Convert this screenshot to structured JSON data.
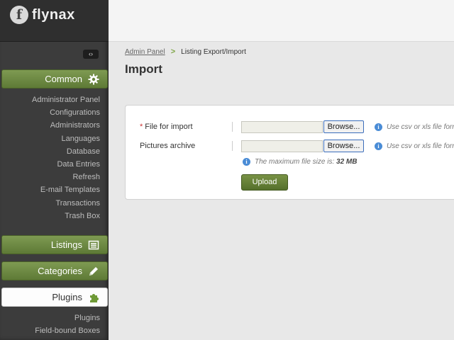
{
  "brand": {
    "logo_letter": "f",
    "name": "flynax"
  },
  "sidebar": {
    "toggle_glyph": "‹›",
    "common": {
      "label": "Common",
      "icon": "gear-icon",
      "items": [
        "Administrator Panel",
        "Configurations",
        "Administrators",
        "Languages",
        "Database",
        "Data Entries",
        "Refresh",
        "E-mail Templates",
        "Transactions",
        "Trash Box"
      ]
    },
    "listings": {
      "label": "Listings",
      "icon": "listings-icon"
    },
    "categories": {
      "label": "Categories",
      "icon": "pencil-icon"
    },
    "plugins": {
      "label": "Plugins",
      "icon": "puzzle-icon",
      "items": [
        "Plugins",
        "Field-bound Boxes"
      ]
    }
  },
  "breadcrumb": {
    "root": "Admin Panel",
    "separator": ">",
    "current": "Listing Export/Import"
  },
  "page_title": "Import",
  "form": {
    "file_label": "File for import",
    "required_mark": "*",
    "archive_label": "Pictures archive",
    "browse_label": "Browse...",
    "file_hint": "Use csv or xls file form",
    "archive_hint": "Use csv or xls file form",
    "max_size_text": "The maximum file size is:",
    "max_size_value": "32 MB",
    "info_glyph": "i",
    "upload_label": "Upload"
  },
  "colors": {
    "accent_green": "#6b8a3c",
    "info_blue": "#4a8cd6",
    "sidebar_bg": "#3c3c3c"
  }
}
